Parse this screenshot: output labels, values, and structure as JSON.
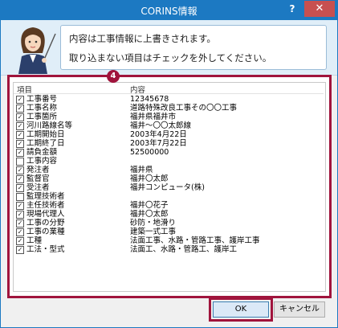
{
  "window": {
    "title": "CORINS情報",
    "help": "?",
    "close": "✕"
  },
  "banner": {
    "line1": "内容は工事情報に上書きされます。",
    "line2": "取り込まない項目はチェックを外してください。"
  },
  "badge": "4",
  "list": {
    "col_item": "項目",
    "col_value": "内容",
    "rows": [
      {
        "checked": true,
        "item": "工事番号",
        "value": "12345678"
      },
      {
        "checked": true,
        "item": "工事名称",
        "value": "道路特殊改良工事その〇〇工事"
      },
      {
        "checked": true,
        "item": "工事箇所",
        "value": "福井県福井市"
      },
      {
        "checked": true,
        "item": "河川路線名等",
        "value": "福井～〇〇太郎線"
      },
      {
        "checked": true,
        "item": "工期開始日",
        "value": "2003年4月22日"
      },
      {
        "checked": true,
        "item": "工期終了日",
        "value": "2003年7月22日"
      },
      {
        "checked": true,
        "item": "請負金額",
        "value": "52500000"
      },
      {
        "checked": false,
        "item": "工事内容",
        "value": ""
      },
      {
        "checked": true,
        "item": "発注者",
        "value": "福井県"
      },
      {
        "checked": true,
        "item": "監督官",
        "value": "福井〇太郎"
      },
      {
        "checked": true,
        "item": "受注者",
        "value": "福井コンピュータ(株)"
      },
      {
        "checked": false,
        "item": "監理技術者",
        "value": ""
      },
      {
        "checked": true,
        "item": "主任技術者",
        "value": "福井〇花子"
      },
      {
        "checked": true,
        "item": "現場代理人",
        "value": "福井〇太郎"
      },
      {
        "checked": true,
        "item": "工事の分野",
        "value": "砂防・地滑り"
      },
      {
        "checked": true,
        "item": "工事の業種",
        "value": "建築一式工事"
      },
      {
        "checked": true,
        "item": "工種",
        "value": "法面工事、水路・管路工事、護岸工事"
      },
      {
        "checked": true,
        "item": "工法・型式",
        "value": "法面工、水路・管路工、護岸工"
      }
    ]
  },
  "buttons": {
    "ok": "OK",
    "cancel": "キャンセル"
  },
  "colors": {
    "titlebar": "#1c79c2",
    "highlight": "#a0143c",
    "close": "#c75050"
  }
}
